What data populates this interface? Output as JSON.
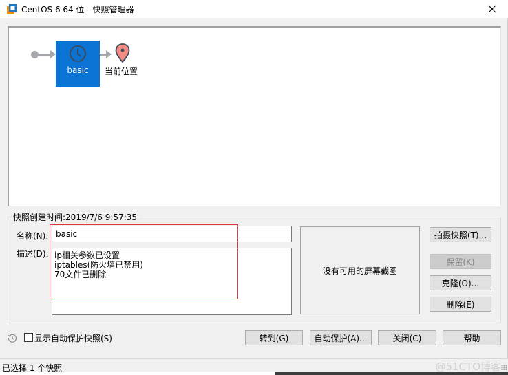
{
  "window": {
    "title": "CentOS 6 64 位 - 快照管理器",
    "app_icon": "vmware-icon",
    "close_icon": "close-icon"
  },
  "tree": {
    "start_icon": "root-dot-icon",
    "snapshots": [
      {
        "name": "basic",
        "icon": "clock-icon",
        "selected": true
      }
    ],
    "current_location": {
      "label": "当前位置",
      "icon": "location-pin-icon"
    },
    "colors": {
      "node": "#0b73d4",
      "connector": "#a5a9ad",
      "pin": "#f28b82"
    }
  },
  "details": {
    "created_label": "快照创建时间:2019/7/6 9:57:35",
    "name_label": "名称(N):",
    "name_value": "basic",
    "desc_label": "描述(D):",
    "desc_value": "ip相关参数已设置\niptables(防火墙已禁用)\n70文件已删除",
    "screenshot_placeholder": "没有可用的屏幕截图"
  },
  "side_buttons": {
    "take_snapshot": "拍摄快照(T)...",
    "keep": "保留(K)",
    "clone": "克隆(O)...",
    "delete": "删除(E)"
  },
  "bottom": {
    "show_autoprotect_label": "显示自动保护快照(S)",
    "show_autoprotect_checked": false,
    "history_icon": "history-icon",
    "goto": "转到(G)",
    "autoprotect": "自动保护(A)...",
    "close": "关闭(C)",
    "help": "帮助"
  },
  "status": {
    "text": "已选择 1 个快照",
    "watermark": "@51CTO博客"
  }
}
